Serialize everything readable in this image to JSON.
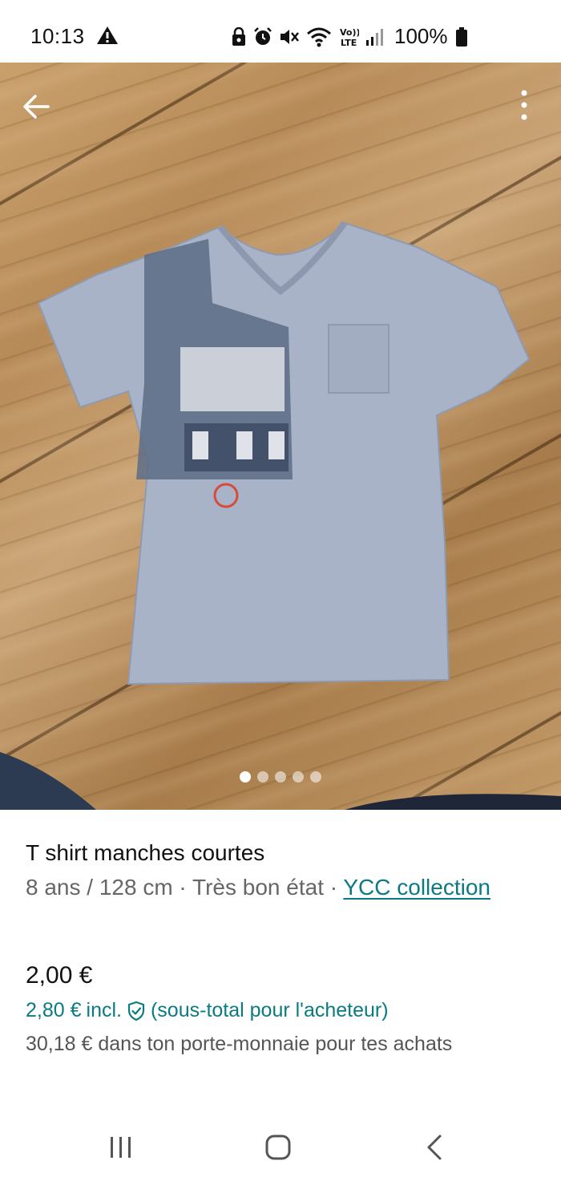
{
  "status_bar": {
    "time": "10:13",
    "battery": "100%",
    "icons": [
      "warning-icon",
      "lock-icon",
      "alarm-icon",
      "mute-icon",
      "wifi-icon",
      "volte-icon",
      "signal-icon",
      "battery-icon"
    ]
  },
  "photo": {
    "image_count": 5,
    "active_index": 0
  },
  "listing": {
    "title": "T shirt manches courtes",
    "meta_prefix": "8 ans / 128 cm · Très bon état · ",
    "brand": "YCC collection",
    "price": "2,00 €",
    "price_incl": "2,80 €",
    "incl_label": "incl.",
    "buyer_subtotal": "(sous-total pour l'acheteur)",
    "wallet_note": "30,18 € dans ton porte-monnaie pour tes achats"
  },
  "colors": {
    "accent": "#0b7a83"
  }
}
